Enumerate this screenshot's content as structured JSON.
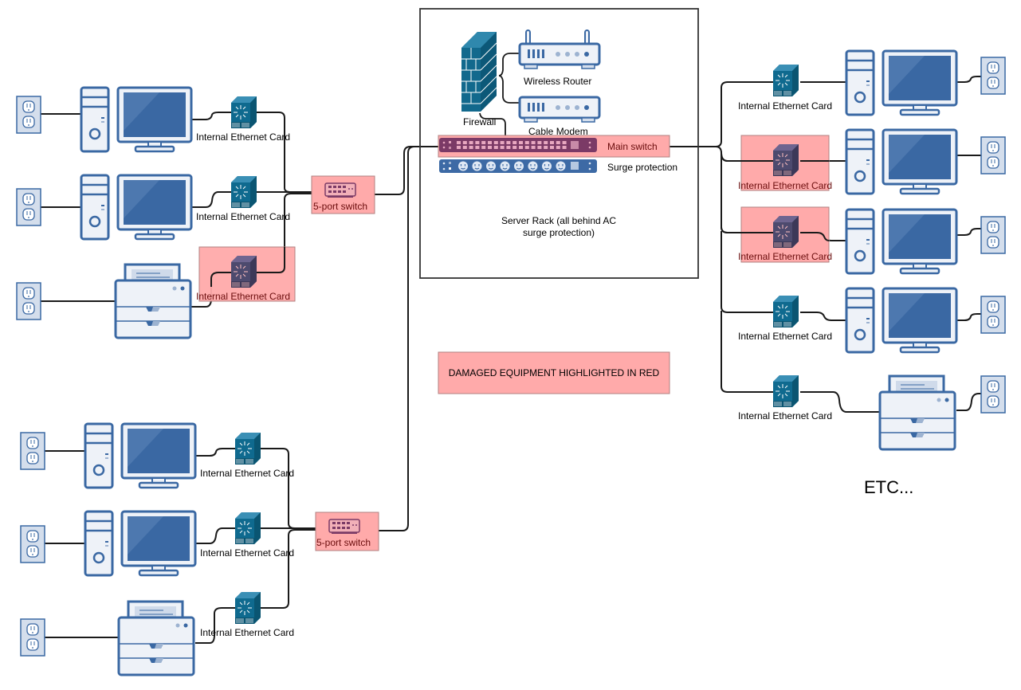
{
  "colors": {
    "device_blue": "#3a68a3",
    "device_fill": "#eef2f8",
    "screen_blue": "#3a68a3",
    "outlet_fill": "#d4deec",
    "nic_teal": "#0f6a8f",
    "nic_damaged": "#4d4a6e",
    "damage_highlight": "#ffaaaa",
    "damage_border": "#b08080",
    "main_switch": "#7b3a66",
    "surge_strip": "#3d6aa5",
    "cable": "#1a1a1a",
    "rack_border": "#333333"
  },
  "server_rack": {
    "label_line1": "Server Rack (all behind AC",
    "label_line2": "surge protection)",
    "firewall_label": "Firewall",
    "wireless_router_label": "Wireless Router",
    "cable_modem_label": "Cable Modem",
    "main_switch_label": "Main switch",
    "main_switch_damaged": true,
    "surge_label": "Surge protection"
  },
  "legend": {
    "text": "DAMAGED EQUIPMENT HIGHLIGHTED IN RED"
  },
  "etc_label": "ETC...",
  "switches": [
    {
      "label": "5-port switch",
      "damaged": true
    },
    {
      "label": "5-port switch",
      "damaged": true
    }
  ],
  "nic_label": "Internal Ethernet Card",
  "groups": {
    "top_left": [
      {
        "device": "computer",
        "nic_damaged": false
      },
      {
        "device": "computer",
        "nic_damaged": false
      },
      {
        "device": "printer",
        "nic_damaged": true
      }
    ],
    "bottom_left": [
      {
        "device": "computer",
        "nic_damaged": false
      },
      {
        "device": "computer",
        "nic_damaged": false
      },
      {
        "device": "printer",
        "nic_damaged": false
      }
    ],
    "right": [
      {
        "device": "computer",
        "nic_damaged": false
      },
      {
        "device": "computer",
        "nic_damaged": true
      },
      {
        "device": "computer",
        "nic_damaged": true
      },
      {
        "device": "computer",
        "nic_damaged": false
      },
      {
        "device": "printer",
        "nic_damaged": false
      }
    ]
  }
}
